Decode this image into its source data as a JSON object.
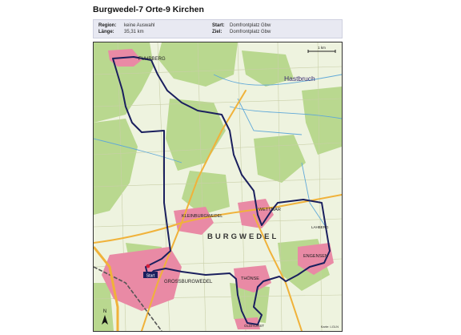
{
  "page": {
    "title": "Burgwedel-7 Orte-9 Kirchen"
  },
  "info": {
    "region_label": "Region:",
    "region_value": "keine Auswahl",
    "length_label": "Länge:",
    "length_value": "35,31 km",
    "start_label": "Start:",
    "start_value": "Domfrontplatz Gbw",
    "goal_label": "Ziel:",
    "goal_value": "Domfrontplatz Gbw"
  },
  "map": {
    "scale_label": "1 km",
    "places": {
      "fuhrberg": "FUHRBERG",
      "hastbruch": "Hastbruch",
      "kleinburgwedel": "KLEINBURGWEDEL",
      "wettmar": "WETTMAR",
      "burgwedel": "BURGWEDEL",
      "engensen": "ENGENSEN",
      "thonse": "THÖNSE",
      "grossburgwedel": "GROSSBURGWEDEL",
      "oldhorst": "OLDHORST",
      "lahberg": "LAHBERG"
    },
    "north_label": "N",
    "copyright": "Karte: LGLN",
    "start_marker_label": "Start",
    "colors": {
      "route": "#1a1f5e",
      "settlement": "#e98aa5",
      "forest": "#b9d88f",
      "meadow": "#eef3df",
      "water": "#5fa8d8",
      "road_major": "#f0b23a",
      "railway": "#555555"
    }
  }
}
